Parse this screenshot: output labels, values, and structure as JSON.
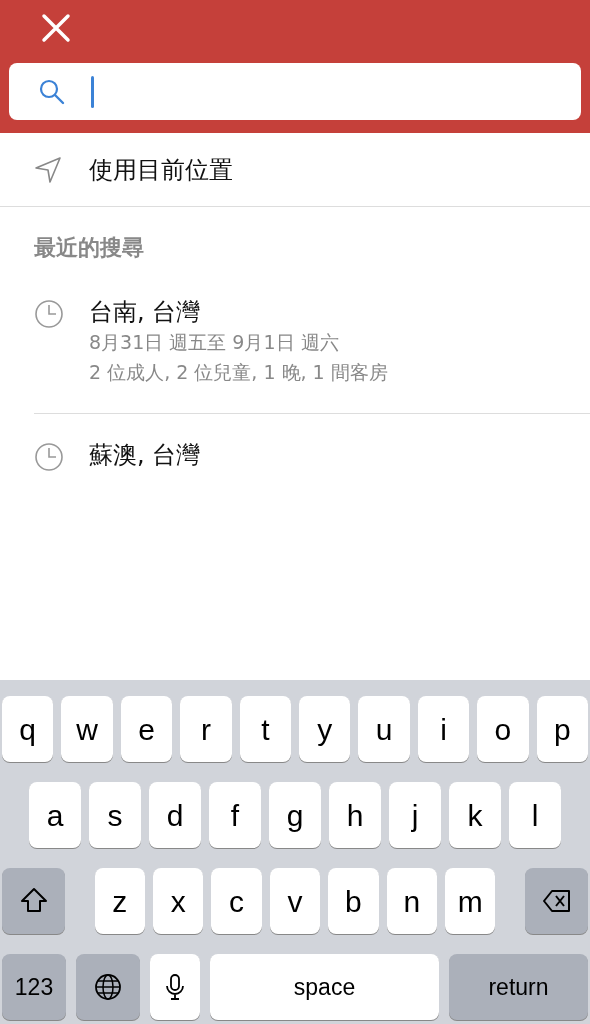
{
  "search": {
    "focused": true
  },
  "current_location": {
    "label": "使用目前位置"
  },
  "recent": {
    "heading": "最近的搜尋",
    "items": [
      {
        "title": "台南, 台灣",
        "details": [
          "8月31日 週五至 9月1日 週六",
          "2 位成人, 2 位兒童, 1 晚, 1 間客房"
        ]
      },
      {
        "title": "蘇澳, 台灣"
      }
    ]
  },
  "keyboard": {
    "rows": [
      {
        "keys": [
          {
            "kind": "letter",
            "label": "q"
          },
          {
            "kind": "letter",
            "label": "w"
          },
          {
            "kind": "letter",
            "label": "e"
          },
          {
            "kind": "letter",
            "label": "r"
          },
          {
            "kind": "letter",
            "label": "t"
          },
          {
            "kind": "letter",
            "label": "y"
          },
          {
            "kind": "letter",
            "label": "u"
          },
          {
            "kind": "letter",
            "label": "i"
          },
          {
            "kind": "letter",
            "label": "o"
          },
          {
            "kind": "letter",
            "label": "p"
          }
        ]
      },
      {
        "keys": [
          {
            "kind": "letter",
            "label": "a"
          },
          {
            "kind": "letter",
            "label": "s"
          },
          {
            "kind": "letter",
            "label": "d"
          },
          {
            "kind": "letter",
            "label": "f"
          },
          {
            "kind": "letter",
            "label": "g"
          },
          {
            "kind": "letter",
            "label": "h"
          },
          {
            "kind": "letter",
            "label": "j"
          },
          {
            "kind": "letter",
            "label": "k"
          },
          {
            "kind": "letter",
            "label": "l"
          }
        ]
      },
      {
        "keys": [
          {
            "kind": "shift"
          },
          {
            "kind": "letter",
            "label": "z"
          },
          {
            "kind": "letter",
            "label": "x"
          },
          {
            "kind": "letter",
            "label": "c"
          },
          {
            "kind": "letter",
            "label": "v"
          },
          {
            "kind": "letter",
            "label": "b"
          },
          {
            "kind": "letter",
            "label": "n"
          },
          {
            "kind": "letter",
            "label": "m"
          },
          {
            "kind": "backspace"
          }
        ]
      },
      {
        "keys": [
          {
            "kind": "numbers",
            "label": "123"
          },
          {
            "kind": "globe"
          },
          {
            "kind": "mic"
          },
          {
            "kind": "space",
            "label": "space"
          },
          {
            "kind": "return",
            "label": "return"
          }
        ]
      }
    ]
  }
}
